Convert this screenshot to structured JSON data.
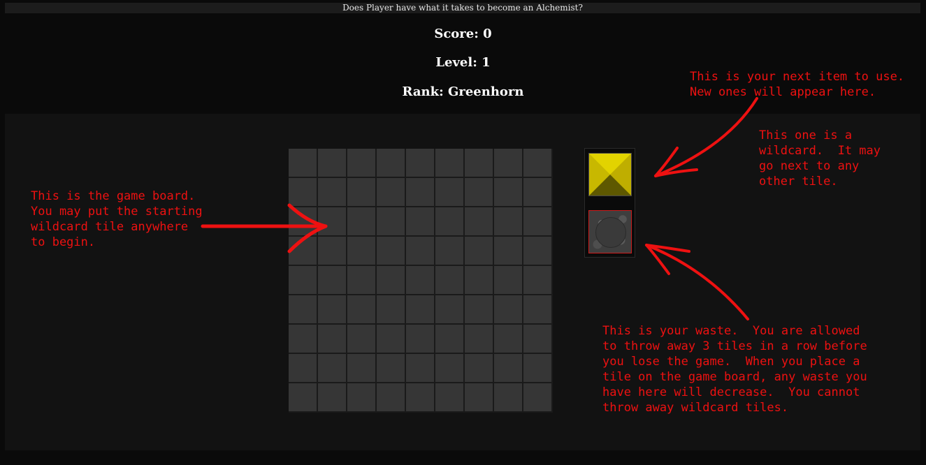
{
  "window": {
    "title": "Does Player have what it takes to become an Alchemist?"
  },
  "stats": {
    "score": "Score: 0",
    "level": "Level: 1",
    "rank": "Rank: Greenhorn"
  },
  "board": {
    "rows": 9,
    "cols": 9
  },
  "side_panel": {
    "next_item_icon": "yellow-pyramid-icon",
    "waste_icon": "stone-waste-icon"
  },
  "annotations": {
    "next_item": "This is your next item to use.\nNew ones will appear here.",
    "wildcard": "This one is a\nwildcard.  It may\ngo next to any\nother tile.",
    "game_board": "This is the game board.\nYou may put the starting\nwildcard tile anywhere\nto begin.",
    "waste": "This is your waste.  You are allowed\nto throw away 3 tiles in a row before\nyou lose the game.  When you place a\ntile on the game board, any waste you\nhave here will decrease.  You cannot\nthrow away wildcard tiles."
  },
  "colors": {
    "annotation": "#ee1111",
    "wildcard_yellow": "#d4c400",
    "cell": "#363636"
  }
}
